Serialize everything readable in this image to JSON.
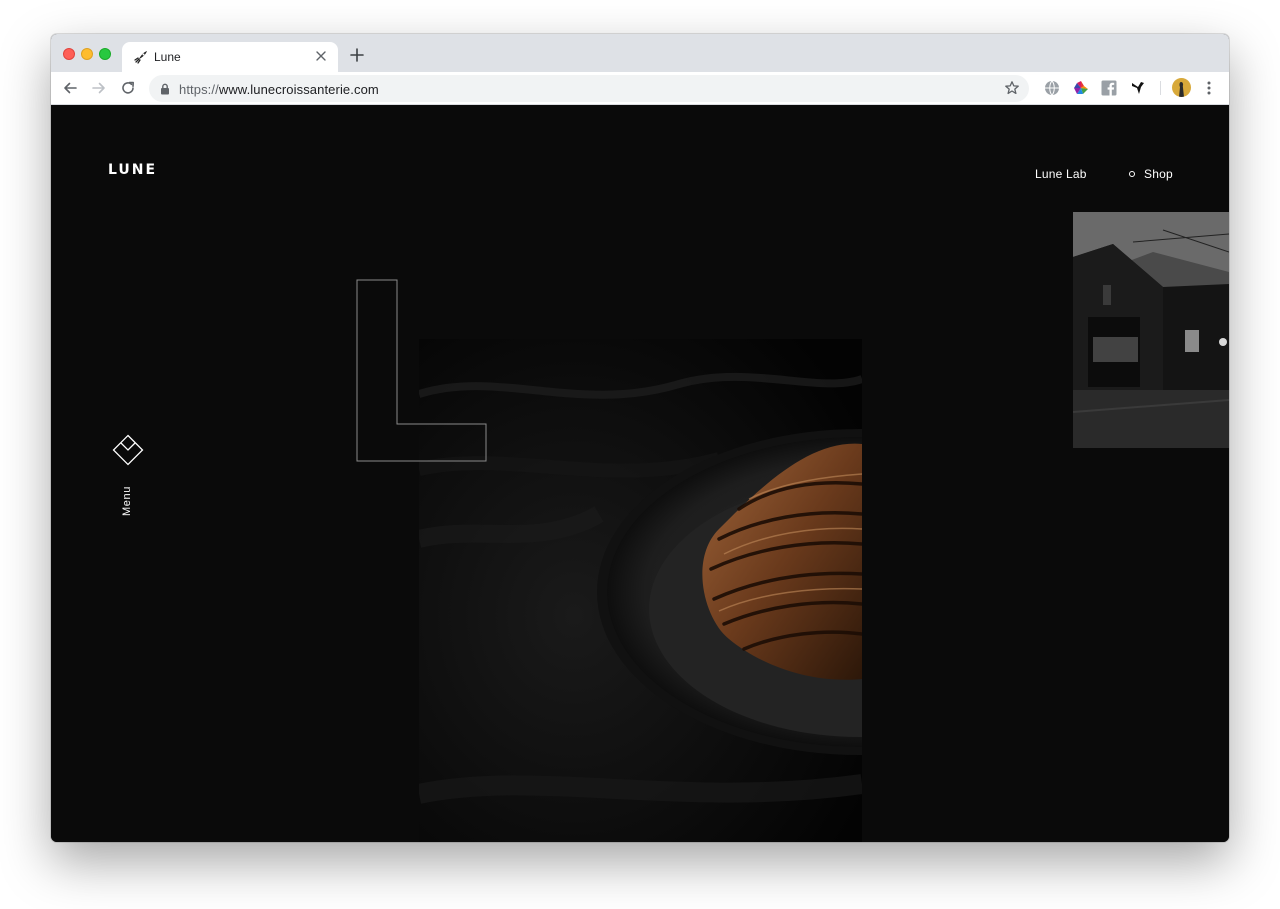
{
  "browser": {
    "tab_title": "Lune",
    "url_scheme": "https://",
    "url_host": "www.lunecroissanterie.com"
  },
  "site": {
    "logo": "LUNE",
    "nav": [
      {
        "label": "Lune Lab"
      },
      {
        "label": "Shop"
      }
    ],
    "menu_label": "Menu",
    "hero_letter": "L"
  },
  "icons": {
    "tab_favicon": "rocket-icon",
    "menu": "diamond-menu-icon"
  },
  "colors": {
    "page_bg": "#0a0a0a",
    "text": "#ffffff"
  }
}
